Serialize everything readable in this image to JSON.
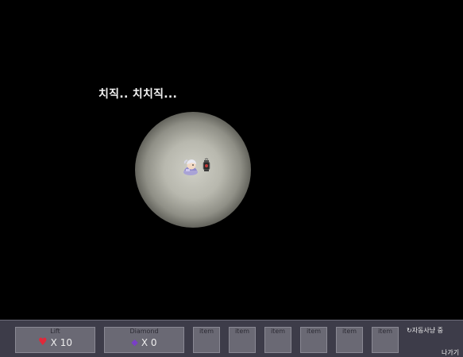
{
  "scene": {
    "dialogue": "치직.. 치치직..."
  },
  "hud": {
    "life": {
      "label": "Lift",
      "count": "X 10",
      "icon": "heart-icon"
    },
    "diamond": {
      "label": "Diamond",
      "count": "X 0",
      "icon": "diamond-icon"
    },
    "items": [
      {
        "label": "item"
      },
      {
        "label": "item"
      },
      {
        "label": "item"
      },
      {
        "label": "item"
      },
      {
        "label": "item"
      },
      {
        "label": "item"
      }
    ],
    "auto_status": "자동사냥 중",
    "auto_icon": "refresh-icon",
    "exit_label": "나가기"
  },
  "colors": {
    "hud_background": "#3d3c49",
    "slot_background": "#6a6974",
    "heart": "#e0293a",
    "diamond": "#7a3fc7"
  }
}
